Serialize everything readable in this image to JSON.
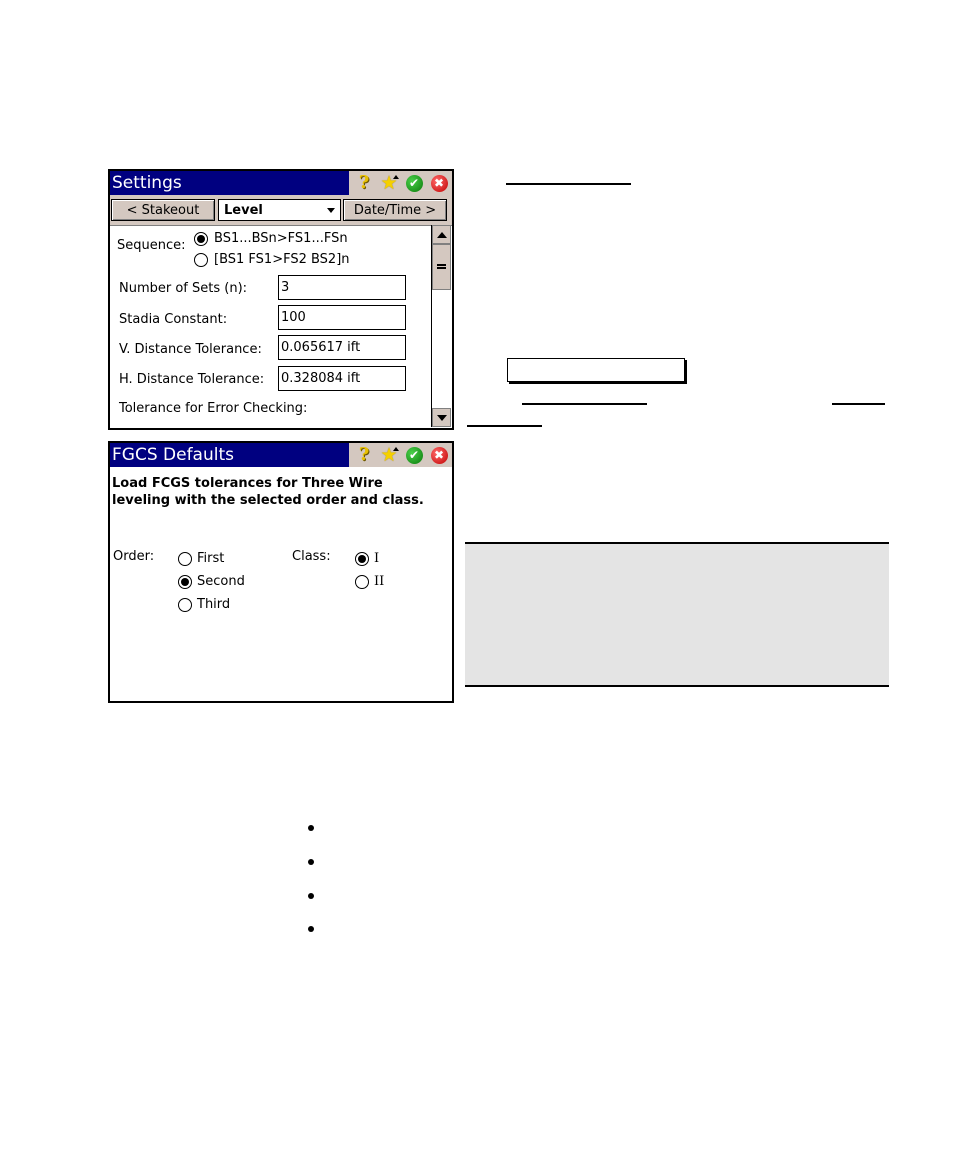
{
  "settings_dialog": {
    "title": "Settings",
    "title_icons": [
      "help-icon",
      "star-icon",
      "ok-icon",
      "close-icon"
    ],
    "prev_button": "< Stakeout",
    "category_select": "Level",
    "next_button": "Date/Time >",
    "sequence_label": "Sequence:",
    "sequence_options": [
      {
        "label": "BS1...BSn>FS1...FSn",
        "selected": true
      },
      {
        "label": "[BS1 FS1>FS2 BS2]n",
        "selected": false
      }
    ],
    "fields": [
      {
        "label": "Number of Sets (n):",
        "value": "3"
      },
      {
        "label": "Stadia Constant:",
        "value": "100"
      },
      {
        "label": "V. Distance Tolerance:",
        "value": "0.065617 ift"
      },
      {
        "label": "H. Distance Tolerance:",
        "value": "0.328084 ift"
      }
    ],
    "trailing_label": "Tolerance for Error Checking:"
  },
  "fgcs_dialog": {
    "title": "FGCS Defaults",
    "title_icons": [
      "help-icon",
      "star-icon",
      "ok-icon",
      "close-icon"
    ],
    "description": "Load FCGS tolerances for Three Wire leveling with the selected order and class.",
    "description_line1": "Load FCGS tolerances for Three Wire",
    "description_line2": "leveling with the selected order and class.",
    "order_label": "Order:",
    "order_options": [
      {
        "label": "First",
        "selected": false
      },
      {
        "label": "Second",
        "selected": true
      },
      {
        "label": "Third",
        "selected": false
      }
    ],
    "class_label": "Class:",
    "class_options": [
      {
        "label": "I",
        "selected": true
      },
      {
        "label": "II",
        "selected": false
      }
    ]
  },
  "colors": {
    "titlebar": "#000080",
    "chrome": "#d4c8c0",
    "note_background": "#e4e4e4"
  },
  "bullets_count": 4
}
